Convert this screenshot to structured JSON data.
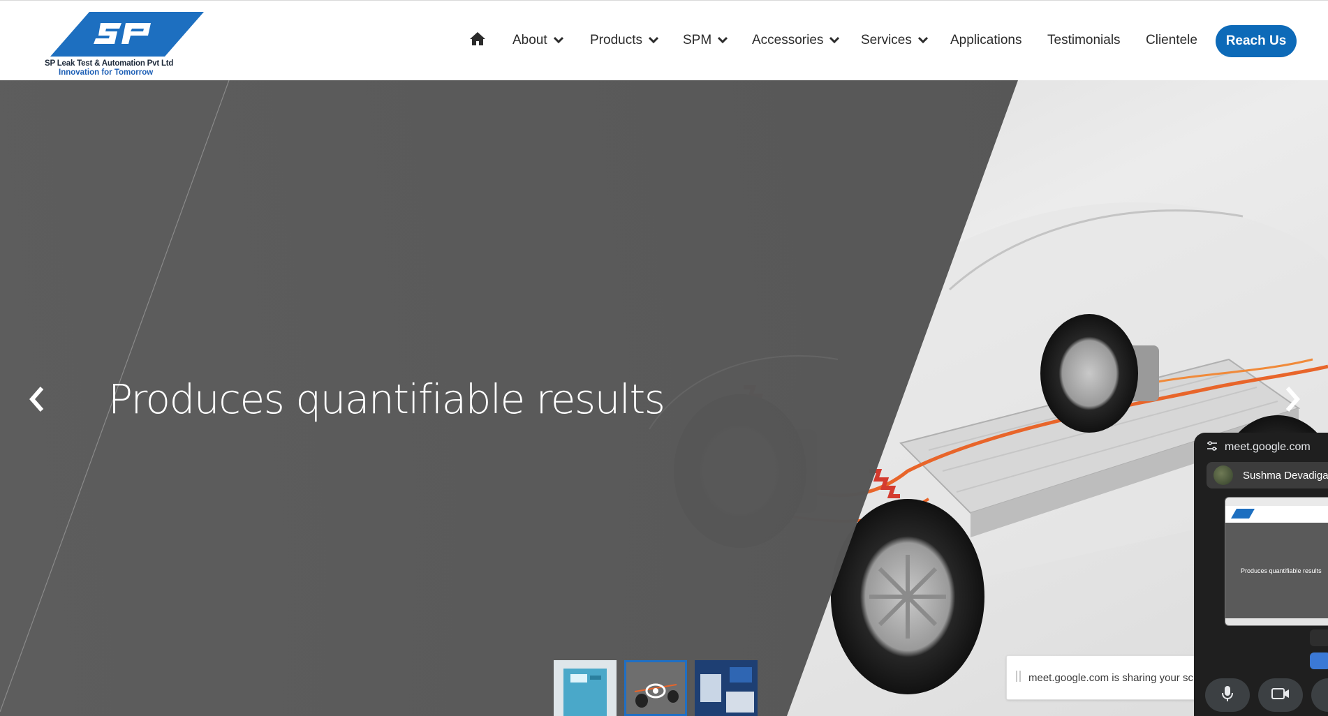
{
  "brand": {
    "logo_letters": "SP",
    "company_name": "SP Leak Test & Automation Pvt Ltd",
    "tagline": "Innovation for Tomorrow",
    "colors": {
      "logo_blue": "#1d6fc0",
      "accent": "#0d6ab8"
    }
  },
  "nav": {
    "home_icon": "home-icon",
    "items": [
      {
        "label": "About",
        "has_dropdown": true
      },
      {
        "label": "Products",
        "has_dropdown": true
      },
      {
        "label": "SPM",
        "has_dropdown": true
      },
      {
        "label": "Accessories",
        "has_dropdown": true
      },
      {
        "label": "Services",
        "has_dropdown": true
      },
      {
        "label": "Applications",
        "has_dropdown": false
      },
      {
        "label": "Testimonials",
        "has_dropdown": false
      },
      {
        "label": "Clientele",
        "has_dropdown": false
      }
    ],
    "cta_label": "Reach Us"
  },
  "hero": {
    "title": "Produces quantifiable results",
    "prev_icon": "chevron-left-icon",
    "next_icon": "chevron-right-icon",
    "thumbnails": [
      {
        "icon": "leak-tester-unit-thumbnail",
        "active": false
      },
      {
        "icon": "ev-chassis-thumbnail",
        "active": true
      },
      {
        "icon": "test-station-thumbnail",
        "active": false
      }
    ]
  },
  "screen_share": {
    "message": "meet.google.com is sharing your scr"
  },
  "meet_pip": {
    "url": "meet.google.com",
    "participant_name": "Sushma Devadiga",
    "preview_title": "Produces quantifiable results",
    "mic_icon": "microphone-icon",
    "camera_icon": "camera-icon"
  }
}
